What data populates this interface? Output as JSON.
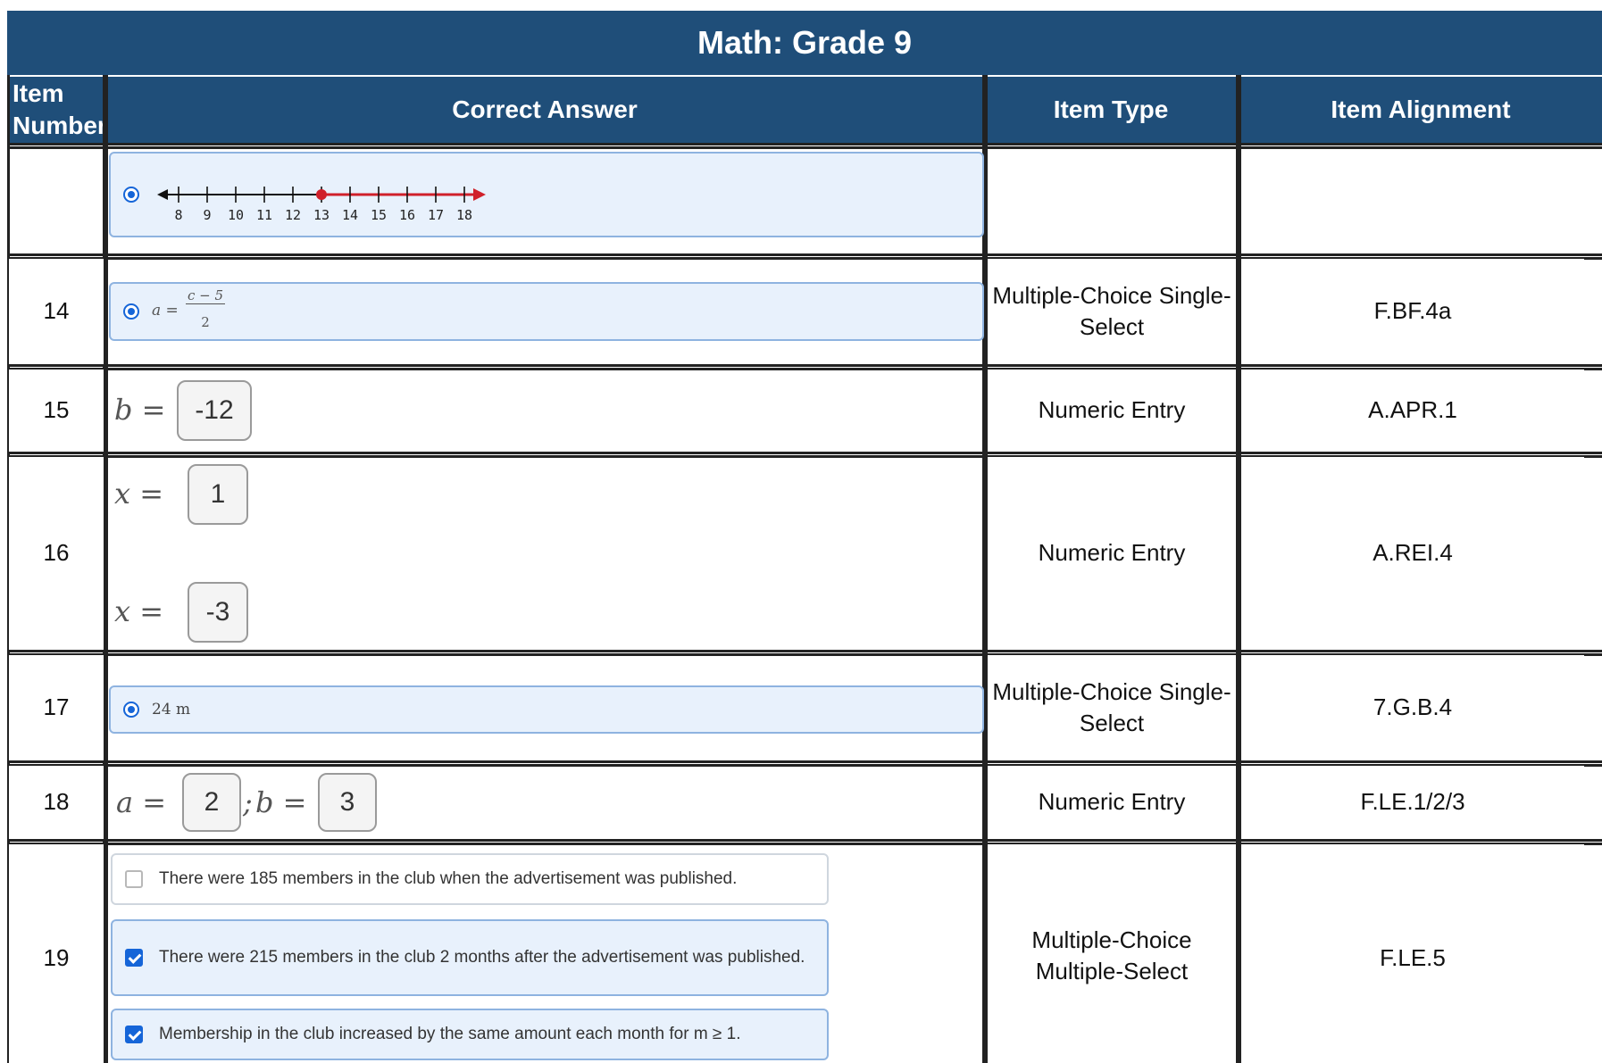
{
  "table": {
    "title": "Math: Grade 9",
    "headers": {
      "item_number": "Item Number",
      "correct_answer": "Correct Answer",
      "item_type": "Item Type",
      "item_alignment": "Item Alignment"
    }
  },
  "rows": [
    {
      "number": "",
      "type": "",
      "alignment": "",
      "answer": {
        "kind": "number-line",
        "ticks": [
          "8",
          "9",
          "10",
          "11",
          "12",
          "13",
          "14",
          "15",
          "16",
          "17",
          "18"
        ],
        "point": 13,
        "ray_direction": "right",
        "ray_color": "#d0202a"
      }
    },
    {
      "number": "14",
      "type": "Multiple-Choice Single-Select",
      "alignment": "F.BF.4a",
      "answer": {
        "kind": "radio",
        "lhs": "a =",
        "numerator": "c − 5",
        "denominator": "2"
      }
    },
    {
      "number": "15",
      "type": "Numeric Entry",
      "alignment": "A.APR.1",
      "answer": {
        "kind": "entry",
        "label": "b =",
        "value": "-12"
      }
    },
    {
      "number": "16",
      "type": "Numeric Entry",
      "alignment": "A.REI.4",
      "answer": {
        "kind": "entry-pair",
        "label1": "x =",
        "value1": "1",
        "label2": "x =",
        "value2": "-3"
      }
    },
    {
      "number": "17",
      "type": "Multiple-Choice Single-Select",
      "alignment": "7.G.B.4",
      "answer": {
        "kind": "radio",
        "text": "24 m"
      }
    },
    {
      "number": "18",
      "type": "Numeric Entry",
      "alignment": "F.LE.1/2/3",
      "answer": {
        "kind": "entry-inline",
        "label_a": "a =",
        "value_a": "2",
        "sep": ";",
        "label_b": "b =",
        "value_b": "3"
      }
    },
    {
      "number": "19",
      "type": "Multiple-Choice Multiple-Select",
      "alignment": "F.LE.5",
      "answer": {
        "kind": "checkbox",
        "options": [
          {
            "text": "There were 185 members in the club when the advertisement was published.",
            "checked": false
          },
          {
            "text": "There were 215 members in the club 2 months after the advertisement was published.",
            "checked": true
          },
          {
            "text": "Membership in the club increased by the same amount each month for m ≥ 1.",
            "checked": true
          }
        ]
      }
    }
  ],
  "colors": {
    "header_bg": "#1f4e79",
    "accent": "#1565d8",
    "selected_bg": "#e8f1fc"
  }
}
